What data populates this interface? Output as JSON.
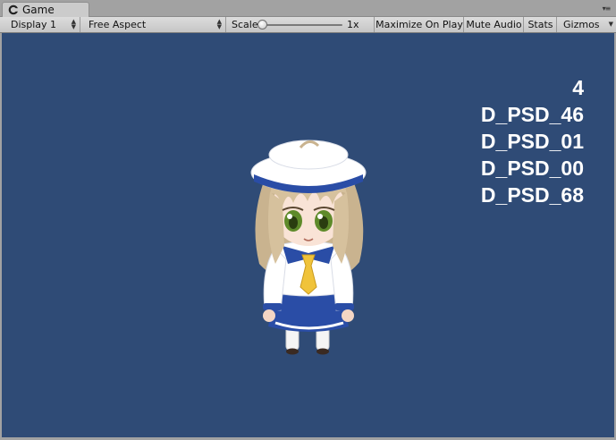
{
  "window": {
    "tab_title": "Game",
    "tab_icon": "unity-game-icon",
    "menu_icon": "window-menu-icon"
  },
  "toolbar": {
    "display": "Display 1",
    "aspect": "Free Aspect",
    "scale_label": "Scale",
    "scale_value": "1x",
    "scale_level": 0.0,
    "maximize_on_play": "Maximize On Play",
    "mute_audio": "Mute Audio",
    "stats": "Stats",
    "gizmos": "Gizmos"
  },
  "viewport": {
    "background_color": "#2f4b76",
    "overlay_lines": [
      "4",
      "D_PSD_46",
      "D_PSD_01",
      "D_PSD_00",
      "D_PSD_68"
    ],
    "character": "chibi-girl-sailor-uniform"
  }
}
